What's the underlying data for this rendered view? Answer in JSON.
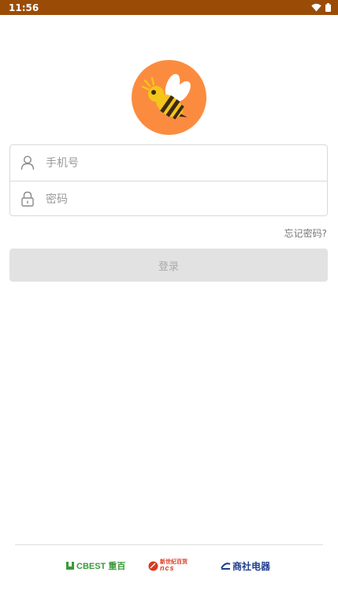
{
  "status_bar": {
    "time": "11:56",
    "wifi_icon": "wifi-icon",
    "battery_icon": "battery-icon"
  },
  "logo": {
    "icon": "bee-icon",
    "background": "#fb8c3f"
  },
  "form": {
    "phone": {
      "icon": "user-icon",
      "placeholder": "手机号",
      "value": ""
    },
    "password": {
      "icon": "lock-icon",
      "placeholder": "密码",
      "value": ""
    }
  },
  "forgot_label": "忘记密码?",
  "login_label": "登录",
  "footer": {
    "brands": [
      {
        "name": "CBEST 重百",
        "color": "#3a9a3a"
      },
      {
        "name_cn": "新世纪百货",
        "name_en": "ncs",
        "color": "#d9381e"
      },
      {
        "name": "商社电器",
        "color": "#1f3f8f"
      }
    ]
  }
}
